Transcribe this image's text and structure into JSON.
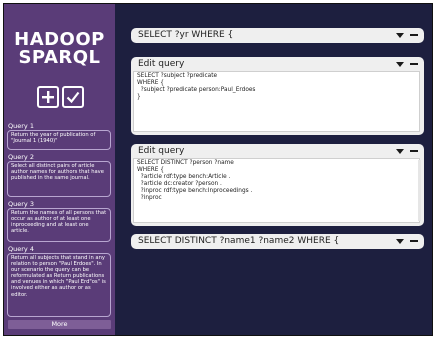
{
  "logo": {
    "line1": "HADOOP",
    "line2": "SPARQL"
  },
  "sidebar": {
    "add_icon": "plus-icon",
    "check_icon": "check-icon",
    "queries": [
      {
        "title": "Query 1",
        "text": "Return the year of publication of \"Journal 1 (1940)\""
      },
      {
        "title": "Query 2",
        "text": "Select all distinct pairs of article author names for authors that have published in the same journal."
      },
      {
        "title": "Query 3",
        "text": "Return the names of all persons that occur as author of at least one inproceeding and at least one article."
      },
      {
        "title": "Query 4",
        "text": "Return all subjects that stand in any relation to person \"Paul Erdoes\". In our scenario the query can be reformulated as Return publications and venues in which \"Paul Erd\"os\" is involved either as author or as editor."
      }
    ],
    "more_label": "More"
  },
  "main": {
    "panels": [
      {
        "title": "SELECT ?yr WHERE {",
        "expanded": false
      },
      {
        "title": "Edit query",
        "expanded": true,
        "query": "SELECT ?subject ?predicate\nWHERE {\n  ?subject ?predicate person:Paul_Erdoes\n}"
      },
      {
        "title": "Edit query",
        "expanded": true,
        "query": "SELECT DISTINCT ?person ?name\nWHERE {\n  ?article rdf:type bench:Article .\n  ?article dc:creator ?person .\n  ?inproc rdf:type bench:Inproceedings .\n  ?inproc"
      },
      {
        "title": "SELECT DISTINCT ?name1 ?name2 WHERE {",
        "expanded": false
      }
    ]
  },
  "colors": {
    "sidebar": "#5a3c78",
    "background": "#1d1f3f",
    "panel": "#efefef",
    "more_button": "#7e5e97"
  }
}
